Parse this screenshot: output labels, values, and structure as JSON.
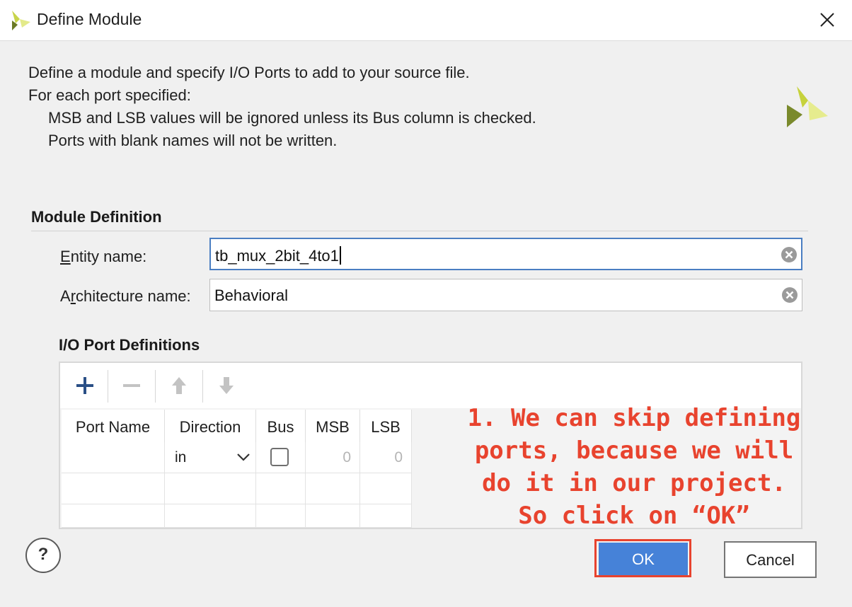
{
  "window": {
    "title": "Define Module",
    "logo_icon": "vivado-logo-icon",
    "close_icon": "close-icon"
  },
  "description": {
    "line1": "Define a module and specify I/O Ports to add to your source file.",
    "line2": "For each port specified:",
    "line3": "MSB and LSB values will be ignored unless its Bus column is checked.",
    "line4": "Ports with blank names will not be written."
  },
  "module_definition": {
    "section_title": "Module Definition",
    "entity_label_mnemonic": "E",
    "entity_label_rest": "ntity name:",
    "entity_value": "tb_mux_2bit_4to1",
    "architecture_label_pre": "A",
    "architecture_label_mnemonic": "r",
    "architecture_label_rest": "chitecture name:",
    "architecture_value": "Behavioral"
  },
  "io_ports": {
    "section_title": "I/O Port Definitions",
    "toolbar": [
      "add-icon",
      "remove-icon",
      "move-up-icon",
      "move-down-icon"
    ],
    "columns": [
      "Port Name",
      "Direction",
      "Bus",
      "MSB",
      "LSB"
    ],
    "rows": [
      {
        "port_name": "",
        "direction": "in",
        "bus": false,
        "msb": "0",
        "lsb": "0"
      }
    ]
  },
  "annotation": {
    "text": "1. We can skip defining\nports, because we will\ndo it in our project.\nSo click on “OK”",
    "color": "#e8432e"
  },
  "buttons": {
    "help": "?",
    "ok": "OK",
    "cancel": "Cancel"
  },
  "colors": {
    "accent": "#4682d8",
    "focus_border": "#4a7ec2",
    "annotation_red": "#e8432e"
  }
}
